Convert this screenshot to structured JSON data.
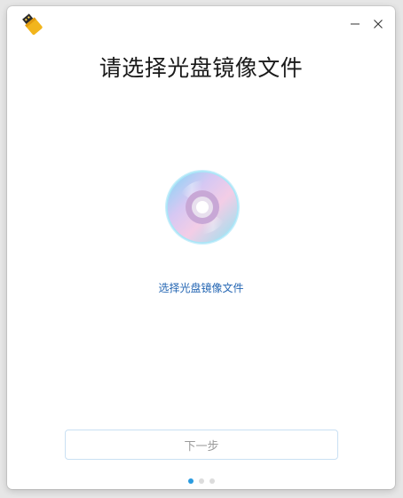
{
  "window": {
    "title": "请选择光盘镜像文件"
  },
  "icons": {
    "app": "usb-drive-icon",
    "minimize": "minimize-icon",
    "close": "close-icon",
    "disc": "disc-icon"
  },
  "content": {
    "select_link": "选择光盘镜像文件"
  },
  "footer": {
    "next_label": "下一步",
    "steps_total": 3,
    "current_step": 1
  },
  "colors": {
    "accent": "#2a9be0",
    "link": "#2466b3",
    "button_border": "#c9e0f3",
    "button_text": "#9a9a9a"
  }
}
